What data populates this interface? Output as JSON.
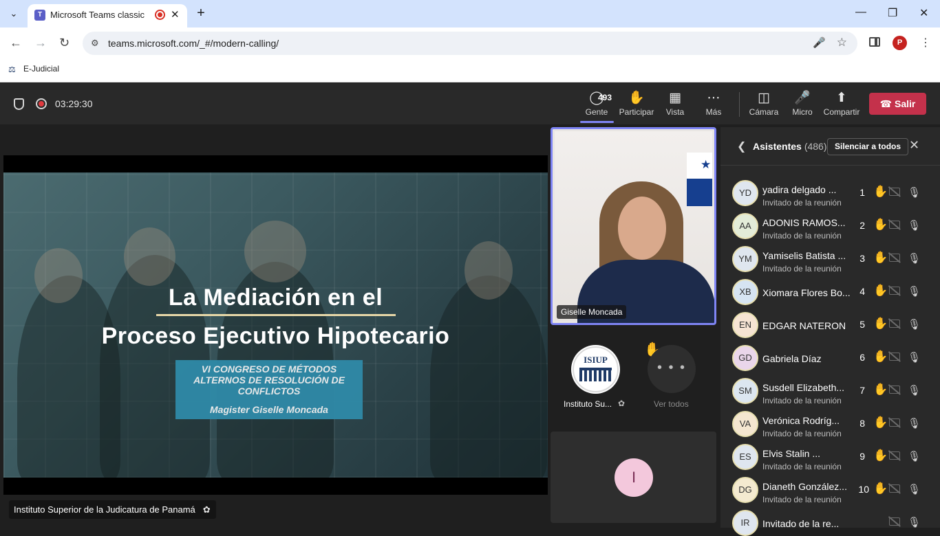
{
  "browser": {
    "tab_title": "Microsoft Teams classic",
    "favicon_letter": "T",
    "url": "teams.microsoft.com/_#/modern-calling/",
    "bookmark": "E-Judicial",
    "profile_letter": "P"
  },
  "meeting": {
    "timer": "03:29:30",
    "toolbar": {
      "people_label": "Gente",
      "people_count": "493",
      "raise_label": "Participar",
      "view_label": "Vista",
      "more_label": "Más",
      "camera_label": "Cámara",
      "mic_label": "Micro",
      "share_label": "Compartir",
      "leave_label": "Salir"
    }
  },
  "slide": {
    "title_line1": "La Mediación en el",
    "title_line2": "Proceso Ejecutivo Hipotecario",
    "subtitle": "VI CONGRESO DE MÉTODOS ALTERNOS DE RESOLUCIÓN DE CONFLICTOS",
    "author": "Magister Giselle Moncada"
  },
  "presenter_label": "Instituto Superior de la Judicatura de Panamá",
  "videos": {
    "main_name": "Giselle Moncada",
    "logo_text": "ISIUP",
    "logo_tile_name": "Instituto Su...",
    "more_label": "Ver todos",
    "more_dots": "• • •",
    "avatar_tile_letter": "I"
  },
  "panel": {
    "title": "Asistentes",
    "count": "(486)",
    "mute_all": "Silenciar a todos",
    "participants": [
      {
        "initials": "YD",
        "name": "yadira delgado ...",
        "role": "Invitado de la reunión",
        "hand": "1",
        "color": "#dfe6ef"
      },
      {
        "initials": "AA",
        "name": "ADONIS RAMOS...",
        "role": "Invitado de la reunión",
        "hand": "2",
        "color": "#e3ecd8"
      },
      {
        "initials": "YM",
        "name": "Yamiselis Batista ...",
        "role": "Invitado de la reunión",
        "hand": "3",
        "color": "#dfe6ef"
      },
      {
        "initials": "XB",
        "name": "Xiomara Flores Bo...",
        "role": "",
        "hand": "4",
        "color": "#d6e4f2"
      },
      {
        "initials": "EN",
        "name": "EDGAR NATERON",
        "role": "",
        "hand": "5",
        "color": "#f6e4d3"
      },
      {
        "initials": "GD",
        "name": "Gabriela Díaz",
        "role": "",
        "hand": "6",
        "color": "#ead6ea"
      },
      {
        "initials": "SM",
        "name": "Susdell Elizabeth...",
        "role": "Invitado de la reunión",
        "hand": "7",
        "color": "#dce6f0"
      },
      {
        "initials": "VA",
        "name": "Verónica Rodríg...",
        "role": "Invitado de la reunión",
        "hand": "8",
        "color": "#f4e6d0"
      },
      {
        "initials": "ES",
        "name": "Elvis Stalin ...",
        "role": "Invitado de la reunión",
        "hand": "9",
        "color": "#dfe6ef"
      },
      {
        "initials": "DG",
        "name": "Dianeth González...",
        "role": "Invitado de la reunión",
        "hand": "10",
        "color": "#f4ead0"
      },
      {
        "initials": "IR",
        "name": "Invitado de la re...",
        "role": "",
        "hand": "",
        "color": "#dfe6ef"
      }
    ]
  }
}
